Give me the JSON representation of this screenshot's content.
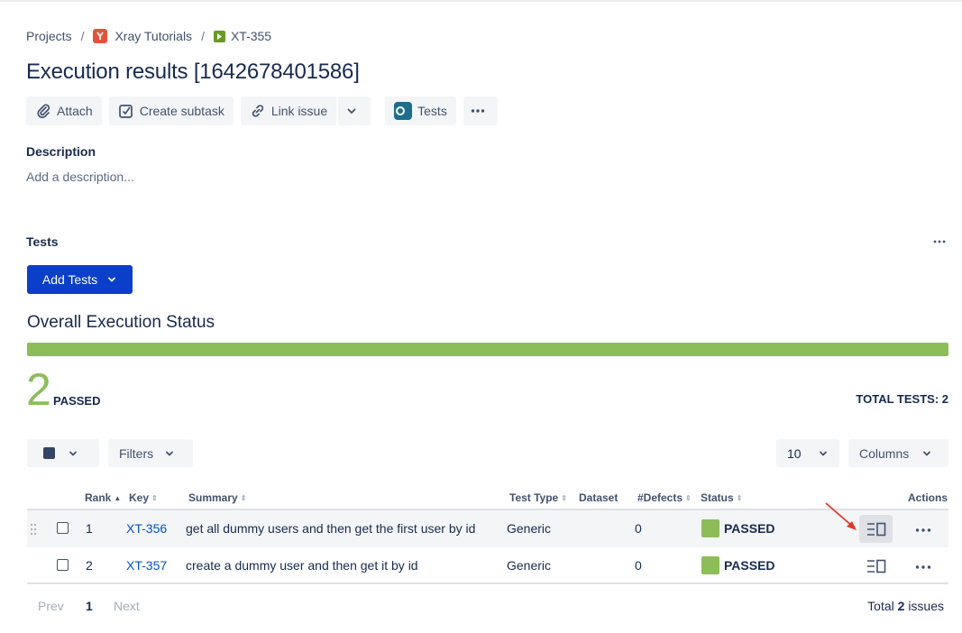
{
  "breadcrumb": {
    "projects": "Projects",
    "project": "Xray Tutorials",
    "issue": "XT-355",
    "separator": "/"
  },
  "title": "Execution results [1642678401586]",
  "toolbar": {
    "attach": "Attach",
    "create_subtask": "Create subtask",
    "link_issue": "Link issue",
    "tests": "Tests"
  },
  "description": {
    "label": "Description",
    "placeholder": "Add a description..."
  },
  "tests_section": {
    "label": "Tests",
    "add_tests": "Add Tests"
  },
  "overall": {
    "title": "Overall Execution Status",
    "progress_passed_fraction": 1.0,
    "passed_count": "2",
    "passed_label": "PASSED",
    "total_tests": "TOTAL TESTS: 2"
  },
  "filters": {
    "filters_label": "Filters",
    "page_size": "10",
    "columns_label": "Columns"
  },
  "table": {
    "headers": {
      "rank": "Rank",
      "key": "Key",
      "summary": "Summary",
      "test_type": "Test Type",
      "dataset": "Dataset",
      "defects": "#Defects",
      "status": "Status",
      "actions": "Actions"
    },
    "rows": [
      {
        "rank": "1",
        "key": "XT-356",
        "summary": "get all dummy users and then get the first user by id",
        "test_type": "Generic",
        "defects": "0",
        "status": "PASSED"
      },
      {
        "rank": "2",
        "key": "XT-357",
        "summary": "create a dummy user and then get it by id",
        "test_type": "Generic",
        "defects": "0",
        "status": "PASSED"
      }
    ]
  },
  "pager": {
    "prev": "Prev",
    "current": "1",
    "next": "Next",
    "total_prefix": "Total",
    "total_count": "2",
    "total_suffix": "issues"
  },
  "colors": {
    "passed": "#8cbd59",
    "primary": "#0b3fc9",
    "link": "#0052cc",
    "annotation": "#e03a2a"
  }
}
